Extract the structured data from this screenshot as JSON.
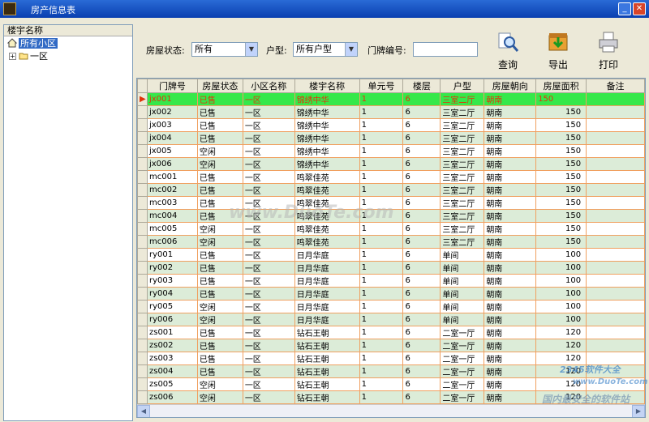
{
  "window": {
    "title": "房产信息表",
    "min": "_",
    "max": "□",
    "close": "✕"
  },
  "tree": {
    "header": "楼宇名称",
    "root": "所有小区",
    "child": "一区"
  },
  "filters": {
    "status_label": "房屋状态:",
    "status_value": "所有",
    "type_label": "户型:",
    "type_value": "所有户型",
    "door_label": "门牌编号:",
    "door_value": ""
  },
  "buttons": {
    "query": "查询",
    "export": "导出",
    "print": "打印"
  },
  "columns": [
    "门牌号",
    "房屋状态",
    "小区名称",
    "楼宇名称",
    "单元号",
    "楼层",
    "户型",
    "房屋朝向",
    "房屋面积",
    "备注"
  ],
  "rows": [
    [
      "jx001",
      "已售",
      "一区",
      "锦绣中华",
      "1",
      "6",
      "三室二厅",
      "朝南",
      "150",
      ""
    ],
    [
      "jx002",
      "已售",
      "一区",
      "锦绣中华",
      "1",
      "6",
      "三室二厅",
      "朝南",
      "150",
      ""
    ],
    [
      "jx003",
      "已售",
      "一区",
      "锦绣中华",
      "1",
      "6",
      "三室二厅",
      "朝南",
      "150",
      ""
    ],
    [
      "jx004",
      "已售",
      "一区",
      "锦绣中华",
      "1",
      "6",
      "三室二厅",
      "朝南",
      "150",
      ""
    ],
    [
      "jx005",
      "空闲",
      "一区",
      "锦绣中华",
      "1",
      "6",
      "三室二厅",
      "朝南",
      "150",
      ""
    ],
    [
      "jx006",
      "空闲",
      "一区",
      "锦绣中华",
      "1",
      "6",
      "三室二厅",
      "朝南",
      "150",
      ""
    ],
    [
      "mc001",
      "已售",
      "一区",
      "鸣翠佳苑",
      "1",
      "6",
      "三室二厅",
      "朝南",
      "150",
      ""
    ],
    [
      "mc002",
      "已售",
      "一区",
      "鸣翠佳苑",
      "1",
      "6",
      "三室二厅",
      "朝南",
      "150",
      ""
    ],
    [
      "mc003",
      "已售",
      "一区",
      "鸣翠佳苑",
      "1",
      "6",
      "三室二厅",
      "朝南",
      "150",
      ""
    ],
    [
      "mc004",
      "已售",
      "一区",
      "鸣翠佳苑",
      "1",
      "6",
      "三室二厅",
      "朝南",
      "150",
      ""
    ],
    [
      "mc005",
      "空闲",
      "一区",
      "鸣翠佳苑",
      "1",
      "6",
      "三室二厅",
      "朝南",
      "150",
      ""
    ],
    [
      "mc006",
      "空闲",
      "一区",
      "鸣翠佳苑",
      "1",
      "6",
      "三室二厅",
      "朝南",
      "150",
      ""
    ],
    [
      "ry001",
      "已售",
      "一区",
      "日月华庭",
      "1",
      "6",
      "单间",
      "朝南",
      "100",
      ""
    ],
    [
      "ry002",
      "已售",
      "一区",
      "日月华庭",
      "1",
      "6",
      "单间",
      "朝南",
      "100",
      ""
    ],
    [
      "ry003",
      "已售",
      "一区",
      "日月华庭",
      "1",
      "6",
      "单间",
      "朝南",
      "100",
      ""
    ],
    [
      "ry004",
      "已售",
      "一区",
      "日月华庭",
      "1",
      "6",
      "单间",
      "朝南",
      "100",
      ""
    ],
    [
      "ry005",
      "空闲",
      "一区",
      "日月华庭",
      "1",
      "6",
      "单间",
      "朝南",
      "100",
      ""
    ],
    [
      "ry006",
      "空闲",
      "一区",
      "日月华庭",
      "1",
      "6",
      "单间",
      "朝南",
      "100",
      ""
    ],
    [
      "zs001",
      "已售",
      "一区",
      "钻石王朝",
      "1",
      "6",
      "二室一厅",
      "朝南",
      "120",
      ""
    ],
    [
      "zs002",
      "已售",
      "一区",
      "钻石王朝",
      "1",
      "6",
      "二室一厅",
      "朝南",
      "120",
      ""
    ],
    [
      "zs003",
      "已售",
      "一区",
      "钻石王朝",
      "1",
      "6",
      "二室一厅",
      "朝南",
      "120",
      ""
    ],
    [
      "zs004",
      "已售",
      "一区",
      "钻石王朝",
      "1",
      "6",
      "二室一厅",
      "朝南",
      "120",
      ""
    ],
    [
      "zs005",
      "空闲",
      "一区",
      "钻石王朝",
      "1",
      "6",
      "二室一厅",
      "朝南",
      "120",
      ""
    ],
    [
      "zs006",
      "空闲",
      "一区",
      "钻石王朝",
      "1",
      "6",
      "二室一厅",
      "朝南",
      "120",
      ""
    ]
  ],
  "selected_row": 0,
  "watermarks": {
    "center": "www.DuoTe.com",
    "br1": "2345软件大全",
    "br2": "www.DuoTe.com",
    "br3": "国内最安全的软件站"
  },
  "colors": {
    "selected_row_bg": "#35e84a",
    "selected_row_text": "#e0340a",
    "alt_row": "#dcecd8",
    "cell_border": "#f0a060"
  }
}
